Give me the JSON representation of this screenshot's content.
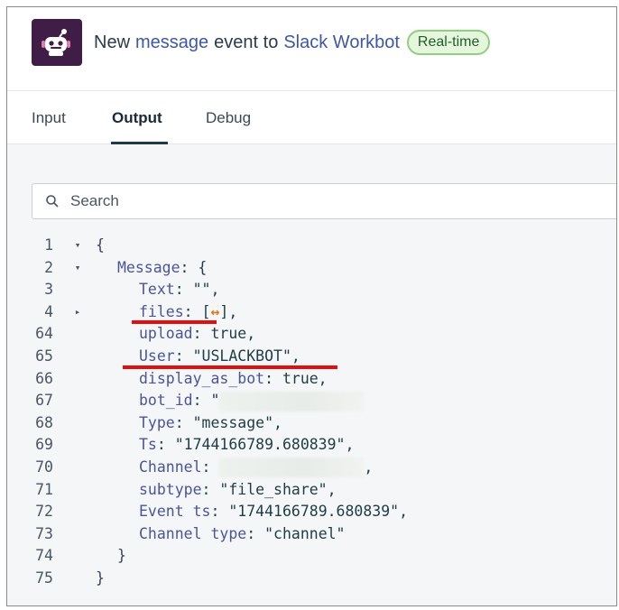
{
  "header": {
    "prefix": "New",
    "object_link": "message",
    "middle": "event to",
    "app_link": "Slack Workbot",
    "badge": "Real-time",
    "app_icon": "slack-workbot-robot-icon",
    "colors": {
      "icon_bg": "#3f1d47",
      "link": "#3e58a6",
      "badge_bg": "#e5f6dd",
      "badge_border": "#8fcf7f"
    }
  },
  "tabs": [
    {
      "label": "Input"
    },
    {
      "label": "Output",
      "active": true
    },
    {
      "label": "Debug"
    }
  ],
  "search": {
    "placeholder": "Search",
    "value": "",
    "icon": "search-icon"
  },
  "code": {
    "lines": [
      {
        "n": "1",
        "toggle": "▾",
        "indent": 0,
        "key": "",
        "text": "{"
      },
      {
        "n": "2",
        "toggle": "▾",
        "indent": 1,
        "key": "Message",
        "text": ": {"
      },
      {
        "n": "3",
        "toggle": "",
        "indent": 2,
        "key": "Text",
        "text": ": \"\","
      },
      {
        "n": "4",
        "toggle": "▸",
        "indent": 2,
        "key": "files",
        "text": ": [",
        "expand": "↔",
        "after": "],"
      },
      {
        "n": "64",
        "toggle": "",
        "indent": 2,
        "key": "upload",
        "text": ": true,"
      },
      {
        "n": "65",
        "toggle": "",
        "indent": 2,
        "key": "User",
        "text": ": \"USLACKBOT\","
      },
      {
        "n": "66",
        "toggle": "",
        "indent": 2,
        "key": "display_as_bot",
        "text": ": true,"
      },
      {
        "n": "67",
        "toggle": "",
        "indent": 2,
        "key": "bot_id",
        "text": ": \"",
        "redacted": true,
        "after": ""
      },
      {
        "n": "68",
        "toggle": "",
        "indent": 2,
        "key": "Type",
        "text": ": \"message\","
      },
      {
        "n": "69",
        "toggle": "",
        "indent": 2,
        "key": "Ts",
        "text": ": \"1744166789.680839\","
      },
      {
        "n": "70",
        "toggle": "",
        "indent": 2,
        "key": "Channel",
        "text": ": ",
        "redacted": true,
        "after": ","
      },
      {
        "n": "71",
        "toggle": "",
        "indent": 2,
        "key": "subtype",
        "text": ": \"file_share\","
      },
      {
        "n": "72",
        "toggle": "",
        "indent": 2,
        "key": "Event ts",
        "text": ": \"1744166789.680839\","
      },
      {
        "n": "73",
        "toggle": "",
        "indent": 2,
        "key": "Channel type",
        "text": ": \"channel\""
      },
      {
        "n": "74",
        "toggle": "",
        "indent": 1,
        "key": "",
        "text": "}"
      },
      {
        "n": "75",
        "toggle": "",
        "indent": 0,
        "key": "",
        "text": "}"
      }
    ],
    "highlight_color": "#e01010"
  }
}
